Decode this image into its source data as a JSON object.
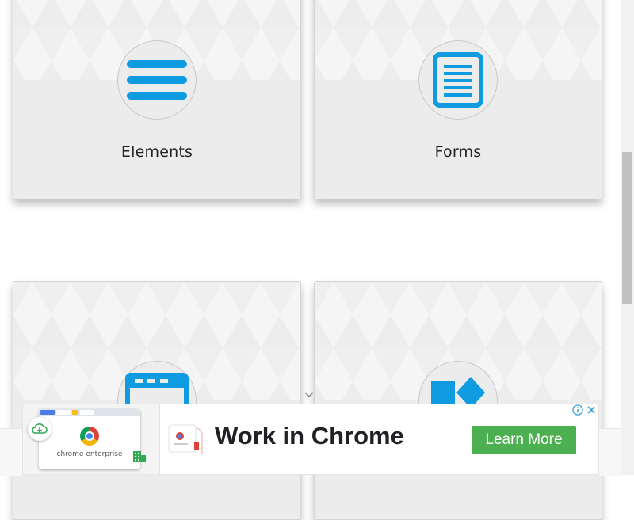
{
  "cards": [
    {
      "title": "Elements",
      "icon": "hamburger-list-icon"
    },
    {
      "title": "Forms",
      "icon": "document-icon"
    },
    {
      "title": "",
      "icon": "browser-window-icon"
    },
    {
      "title": "",
      "icon": "widgets-shapes-icon"
    }
  ],
  "ad": {
    "caption": "chrome enterprise",
    "headline": "Work in Chrome",
    "cta_label": "Learn More",
    "choices_icons": [
      "info-icon",
      "close-icon"
    ]
  },
  "colors": {
    "accent_blue": "#0f9be0",
    "cta_green": "#4caf50",
    "card_bg": "#ececec"
  }
}
